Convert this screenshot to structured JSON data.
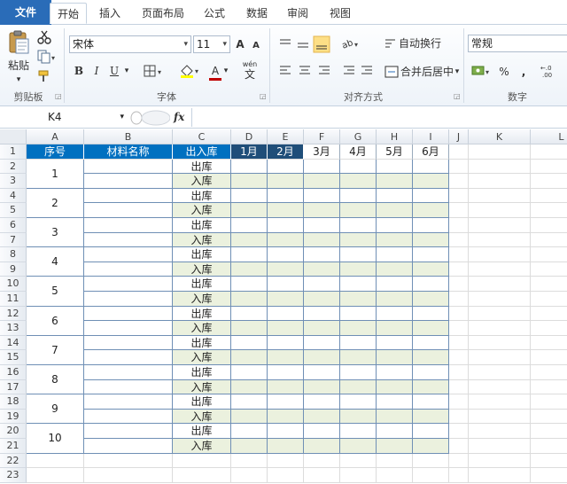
{
  "tabs": [
    "文件",
    "开始",
    "插入",
    "页面布局",
    "公式",
    "数据",
    "审阅",
    "视图"
  ],
  "ribbon": {
    "clipboard": {
      "paste_label": "粘贴",
      "group_label": "剪贴板"
    },
    "font": {
      "font_name": "宋体",
      "font_size": "11",
      "bold": "B",
      "italic": "I",
      "underline": "U",
      "grow": "A",
      "shrink": "A",
      "color_a": "A",
      "wen": "wén",
      "wen_char": "文",
      "group_label": "字体"
    },
    "alignment": {
      "wrap_text": "自动换行",
      "merge_center": "合并后居中",
      "group_label": "对齐方式"
    },
    "number": {
      "format": "常规",
      "percent": "%",
      "comma": ",",
      "group_label": "数字"
    }
  },
  "formula_bar": {
    "name_box": "K4",
    "fx": "fx",
    "value": ""
  },
  "columns": [
    "A",
    "B",
    "C",
    "D",
    "E",
    "F",
    "G",
    "H",
    "I",
    "J",
    "K",
    "L"
  ],
  "rows": [
    "1",
    "2",
    "3",
    "4",
    "5",
    "6",
    "7",
    "8",
    "9",
    "10",
    "11",
    "12",
    "13",
    "14",
    "15",
    "16",
    "17",
    "18",
    "19",
    "20",
    "21",
    "22",
    "23"
  ],
  "table": {
    "headers": [
      "序号",
      "材料名称",
      "出入库",
      "1月",
      "2月",
      "3月",
      "4月",
      "5月",
      "6月"
    ],
    "items": [
      "1",
      "2",
      "3",
      "4",
      "5",
      "6",
      "7",
      "8",
      "9",
      "10"
    ],
    "out_label": "出库",
    "in_label": "入库"
  }
}
